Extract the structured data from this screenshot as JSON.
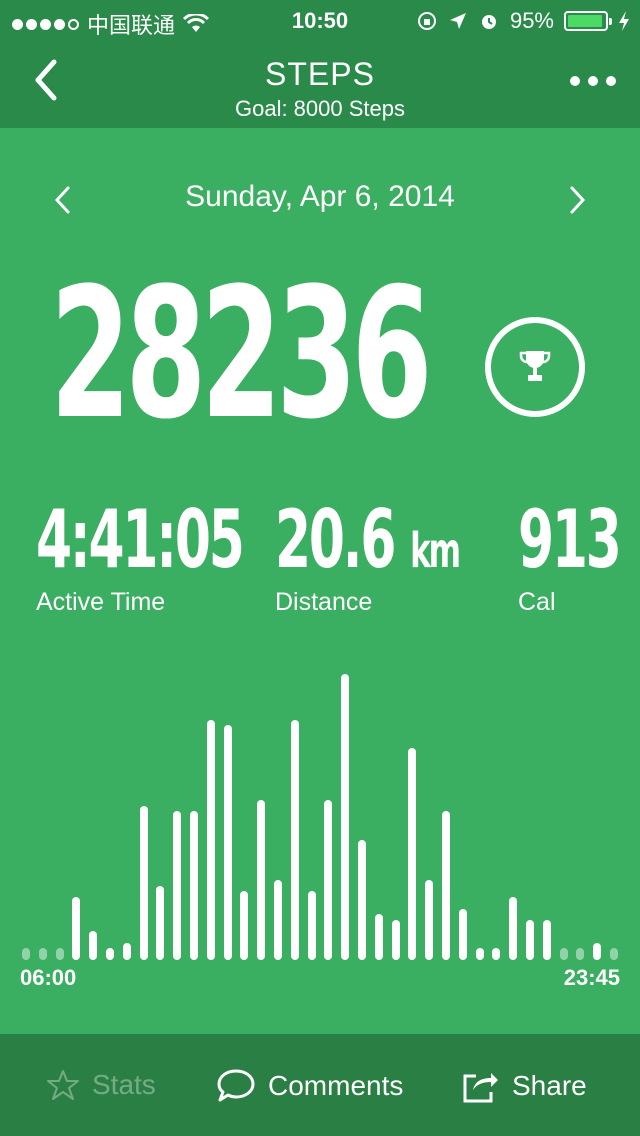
{
  "status_bar": {
    "carrier": "中国联通",
    "time": "10:50",
    "battery": "95%",
    "battery_level": 0.95,
    "icons": [
      "signal-dots",
      "wifi-icon",
      "orientation-lock-icon",
      "location-arrow-icon",
      "alarm-icon",
      "battery-icon",
      "charging-icon"
    ]
  },
  "nav": {
    "title": "STEPS",
    "subtitle": "Goal: 8000 Steps",
    "back_icon": "chevron-left-icon",
    "more_icon": "more-dots-icon"
  },
  "date_nav": {
    "date": "Sunday, Apr 6, 2014",
    "prev_icon": "chevron-left-icon",
    "next_icon": "chevron-right-icon"
  },
  "steps": {
    "value": "28236",
    "badge_icon": "trophy-icon"
  },
  "stats": {
    "active_time": {
      "value": "4:41:05",
      "label": "Active Time"
    },
    "distance": {
      "value": "20.6",
      "unit": "km",
      "label": "Distance"
    },
    "calories": {
      "value": "913",
      "label": "Cal"
    }
  },
  "chart_data": {
    "type": "bar",
    "x_start_label": "06:00",
    "x_end_label": "23:45",
    "values": [
      2,
      2,
      2,
      11,
      5,
      2,
      3,
      27,
      13,
      26,
      26,
      42,
      41,
      12,
      28,
      14,
      42,
      12,
      28,
      50,
      21,
      8,
      7,
      37,
      14,
      26,
      9,
      2,
      2,
      11,
      7,
      7,
      2,
      2,
      3,
      2
    ],
    "dimmed_indices": [
      0,
      1,
      2,
      32,
      33,
      35
    ],
    "ylim": [
      0,
      50
    ],
    "bar_color": "#ffffff"
  },
  "toolbar": {
    "stats": {
      "label": "Stats",
      "icon": "star-icon",
      "enabled": false
    },
    "comments": {
      "label": "Comments",
      "icon": "speech-bubble-icon"
    },
    "share": {
      "label": "Share",
      "icon": "share-icon"
    }
  },
  "colors": {
    "background": "#3aae61",
    "header": "#2a8a4a",
    "toolbar": "#2a7f44"
  }
}
